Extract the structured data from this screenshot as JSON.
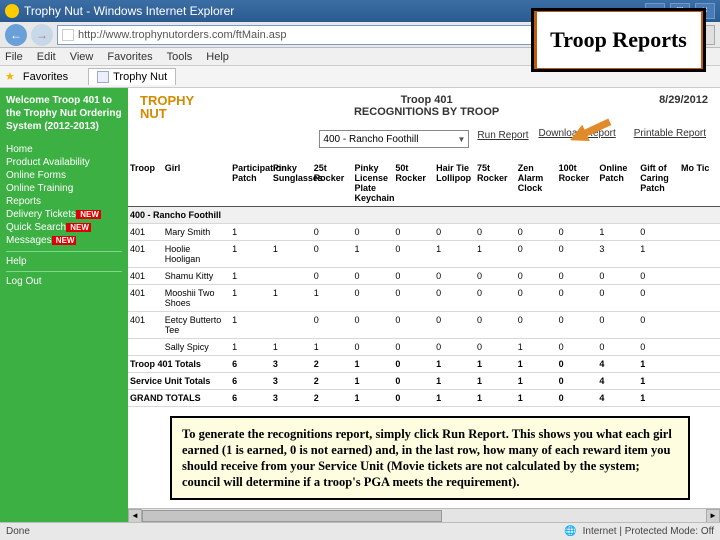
{
  "window": {
    "title": "Trophy Nut - Windows Internet Explorer",
    "url": "http://www.trophynutorders.com/ftMain.asp",
    "status_left": "Done",
    "status_right": "Internet | Protected Mode: Off"
  },
  "menu": {
    "items": [
      "File",
      "Edit",
      "View",
      "Favorites",
      "Tools",
      "Help"
    ]
  },
  "favorites": {
    "label": "Favorites",
    "tab": "Trophy Nut"
  },
  "overlay": {
    "title": "Troop Reports"
  },
  "sidebar": {
    "welcome": "Welcome Troop 401 to the Trophy Nut Ordering System (2012-2013)",
    "items": [
      {
        "label": "Home",
        "new": false
      },
      {
        "label": "Product Availability",
        "new": false
      },
      {
        "label": "Online Forms",
        "new": false
      },
      {
        "label": "Online Training",
        "new": false
      },
      {
        "label": "Reports",
        "new": false
      },
      {
        "label": "Delivery Tickets",
        "new": true
      },
      {
        "label": "Quick Search",
        "new": true
      },
      {
        "label": "Messages",
        "new": true
      }
    ],
    "help": "Help",
    "logout": "Log Out"
  },
  "main": {
    "logo": [
      "TROPHY",
      "NUT"
    ],
    "troop": "Troop 401",
    "report_name": "RECOGNITIONS BY TROOP",
    "date": "8/29/2012",
    "selector": "400 - Rancho Foothill",
    "run": "Run Report",
    "dl": "Download Report",
    "print": "Printable Report"
  },
  "table": {
    "headers": [
      "Troop",
      "Girl",
      "Participation Patch",
      "Pinky Sunglasses",
      "25t Rocker",
      "Pinky License Plate Keychain",
      "50t Rocker",
      "Hair Tie Lollipop",
      "75t Rocker",
      "Zen Alarm Clock",
      "100t Rocker",
      "Online Patch",
      "Gift of Caring Patch",
      "Mo Tic"
    ],
    "group": "400 - Rancho Foothill",
    "rows": [
      {
        "troop": "401",
        "girl": "Mary Smith",
        "v": [
          "1",
          "",
          "0",
          "0",
          "0",
          "0",
          "0",
          "0",
          "0",
          "1",
          "0",
          ""
        ]
      },
      {
        "troop": "401",
        "girl": "Hoolie Hooligan",
        "v": [
          "1",
          "1",
          "0",
          "1",
          "0",
          "1",
          "1",
          "0",
          "0",
          "3",
          "1",
          ""
        ]
      },
      {
        "troop": "401",
        "girl": "Shamu Kitty",
        "v": [
          "1",
          "",
          "0",
          "0",
          "0",
          "0",
          "0",
          "0",
          "0",
          "0",
          "0",
          ""
        ]
      },
      {
        "troop": "401",
        "girl": "Mooshii Two Shoes",
        "v": [
          "1",
          "1",
          "1",
          "0",
          "0",
          "0",
          "0",
          "0",
          "0",
          "0",
          "0",
          ""
        ]
      },
      {
        "troop": "401",
        "girl": "Eetcy Butterto Tee",
        "v": [
          "1",
          "",
          "0",
          "0",
          "0",
          "0",
          "0",
          "0",
          "0",
          "0",
          "0",
          ""
        ]
      },
      {
        "troop": "",
        "girl": "Sally Spicy",
        "v": [
          "1",
          "1",
          "1",
          "0",
          "0",
          "0",
          "0",
          "1",
          "0",
          "0",
          "0",
          ""
        ]
      }
    ],
    "totals": [
      {
        "label": "Troop 401 Totals",
        "v": [
          "6",
          "3",
          "2",
          "1",
          "0",
          "1",
          "1",
          "1",
          "0",
          "4",
          "1",
          ""
        ]
      },
      {
        "label": "Service Unit Totals",
        "v": [
          "6",
          "3",
          "2",
          "1",
          "0",
          "1",
          "1",
          "1",
          "0",
          "4",
          "1",
          ""
        ]
      },
      {
        "label": "GRAND TOTALS",
        "v": [
          "6",
          "3",
          "2",
          "1",
          "0",
          "1",
          "1",
          "1",
          "0",
          "4",
          "1",
          ""
        ]
      }
    ]
  },
  "caption": "To generate the recognitions report, simply click Run Report. This shows you what each girl earned (1 is earned, 0 is not earned) and, in the last row, how many of each reward item you should receive from your Service Unit (Movie tickets are not calculated by the system; council will determine if a troop's PGA meets the requirement)."
}
